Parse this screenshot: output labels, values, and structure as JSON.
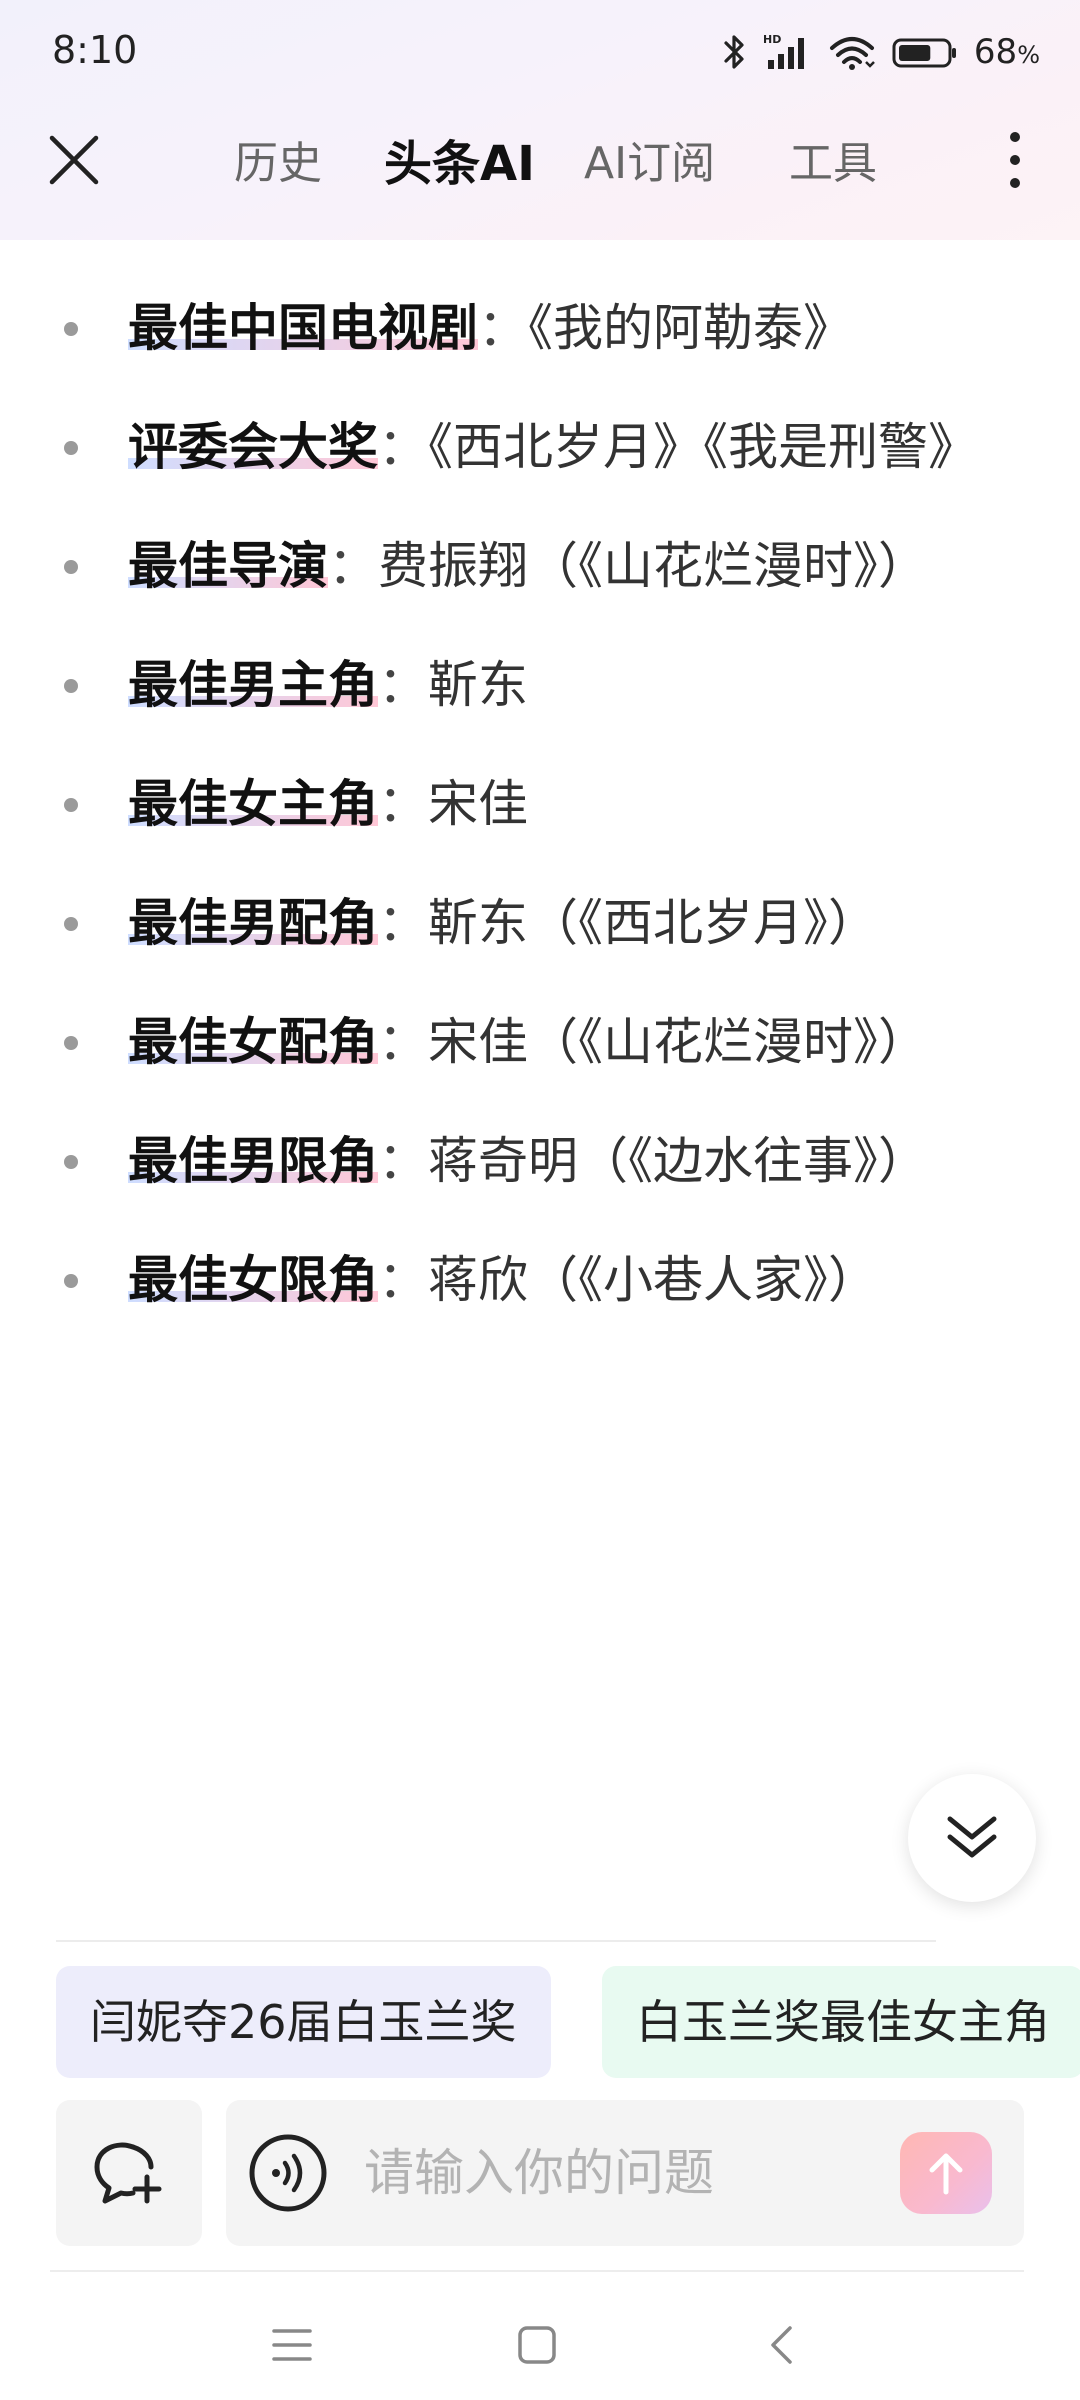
{
  "status_bar": {
    "time": "8:10",
    "battery_percent": "68",
    "battery_unit": "%",
    "battery_level": 0.68,
    "icons": [
      "bluetooth-icon",
      "hd-signal-icon",
      "wifi-icon",
      "battery-icon"
    ]
  },
  "nav": {
    "close_icon": "close-icon",
    "tabs": [
      {
        "label": "历史",
        "active": false
      },
      {
        "label": "头条AI",
        "active": true
      },
      {
        "label": "AI订阅",
        "active": false
      },
      {
        "label": "工具",
        "active": false
      }
    ],
    "more_icon": "more-vertical-icon"
  },
  "awards": [
    {
      "name": "最佳中国电视剧",
      "sep": "：",
      "value": "《我的阿勒泰》"
    },
    {
      "name": "评委会大奖",
      "sep": "：",
      "value": "《西北岁月》《我是刑警》"
    },
    {
      "name": "最佳导演",
      "sep": "：",
      "value": "费振翔（《山花烂漫时》）"
    },
    {
      "name": "最佳男主角",
      "sep": "：",
      "value": "靳东"
    },
    {
      "name": "最佳女主角",
      "sep": "：",
      "value": "宋佳"
    },
    {
      "name": "最佳男配角",
      "sep": "：",
      "value": "靳东（《西北岁月》）"
    },
    {
      "name": "最佳女配角",
      "sep": "：",
      "value": "宋佳（《山花烂漫时》）"
    },
    {
      "name": "最佳男限角",
      "sep": "：",
      "value": "蒋奇明（《边水往事》）"
    },
    {
      "name": "最佳女限角",
      "sep": "：",
      "value": "蒋欣（《小巷人家》）"
    }
  ],
  "suggestions": [
    {
      "label": "闫妮夺26届白玉兰奖"
    },
    {
      "label": "白玉兰奖最佳女主角"
    }
  ],
  "input": {
    "placeholder": "请输入你的问题",
    "value": ""
  },
  "colors": {
    "accent_gradient_start": "#ffb7b3",
    "accent_gradient_end": "#e9c0ec",
    "chip_purple": "#ededfb",
    "chip_green": "#e8faf1",
    "highlight_blue": "#bed2ff",
    "highlight_pink": "#ffb4c8"
  }
}
